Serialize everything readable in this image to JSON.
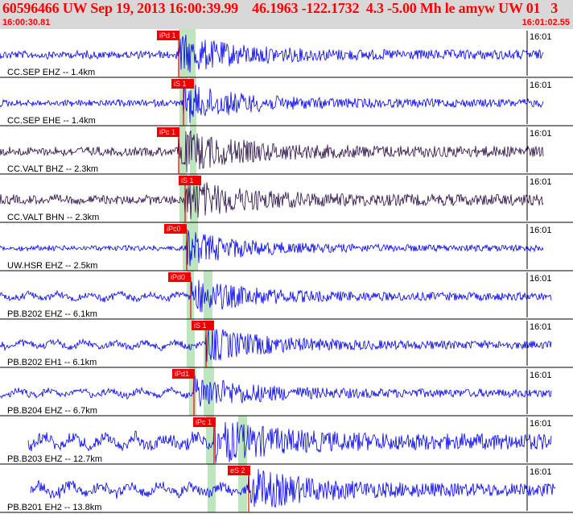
{
  "header": {
    "title": "60596466 UW Sep 19, 2013 16:00:39.99    46.1963 -122.1732  4.3 -5.00 Mh le amyw UW 01   3",
    "start_time": "16:00:30.81",
    "end_time": "16:01:02.55"
  },
  "colors": {
    "trace_blue": "#0000ee",
    "trace_purple": "#2a0f45",
    "pick_red": "#ee0000",
    "window_green": "#bfe5bf",
    "header_bg": "#d8d8d8"
  },
  "traces": [
    {
      "label": "CC.SEP EHZ -- 1.4km",
      "time_label": "16:01",
      "pick": "iPd 1",
      "color": "blue"
    },
    {
      "label": "CC.SEP EHE -- 1.4km",
      "time_label": "16:01",
      "pick": "iS 1",
      "color": "blue"
    },
    {
      "label": "CC.VALT BHZ -- 2.3km",
      "time_label": "16:01",
      "pick": "iPc 1",
      "color": "purple"
    },
    {
      "label": "CC.VALT BHN -- 2.3km",
      "time_label": "16:01",
      "pick": "iS 1",
      "color": "purple"
    },
    {
      "label": "UW.HSR EHZ -- 2.5km",
      "time_label": "16:01",
      "pick": "iPc0",
      "color": "blue"
    },
    {
      "label": "PB.B202 EHZ -- 6.1km",
      "time_label": "16:01",
      "pick": "iPd0",
      "color": "blue"
    },
    {
      "label": "PB.B202 EH1 -- 6.1km",
      "time_label": "16:01",
      "pick": "iS 1",
      "color": "blue"
    },
    {
      "label": "PB.B204 EHZ -- 6.7km",
      "time_label": "16:01",
      "pick": "iPd1",
      "color": "blue"
    },
    {
      "label": "PB.B203 EHZ -- 12.7km",
      "time_label": "16:01",
      "pick": "iPc 1",
      "color": "blue"
    },
    {
      "label": "PB.B201 EH2 -- 13.8km",
      "time_label": "16:01",
      "pick": "eS 2",
      "color": "blue"
    }
  ]
}
